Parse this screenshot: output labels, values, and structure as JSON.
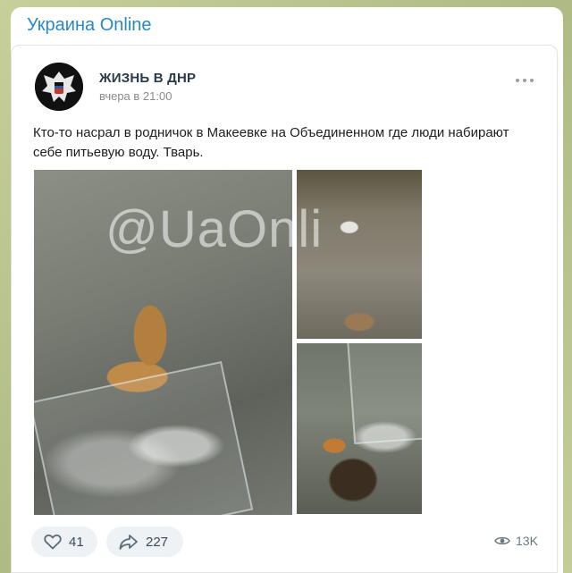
{
  "channel": {
    "title": "Украина Online"
  },
  "post": {
    "author": "ЖИЗНЬ В ДНР",
    "time": "вчера в 21:00",
    "text": "Кто-то насрал в родничок в Макеевке на Объединенном где люди набирают себе питьевую воду. Тварь.",
    "watermark": "@UaOnli",
    "likes": "41",
    "shares": "227",
    "views": "13K"
  },
  "icons": {
    "more": "more-dots-icon",
    "like": "heart-icon",
    "share": "share-arrow-icon",
    "views": "eye-icon"
  },
  "colors": {
    "channel_title": "#2a88c7",
    "background": "#b9c48f"
  }
}
